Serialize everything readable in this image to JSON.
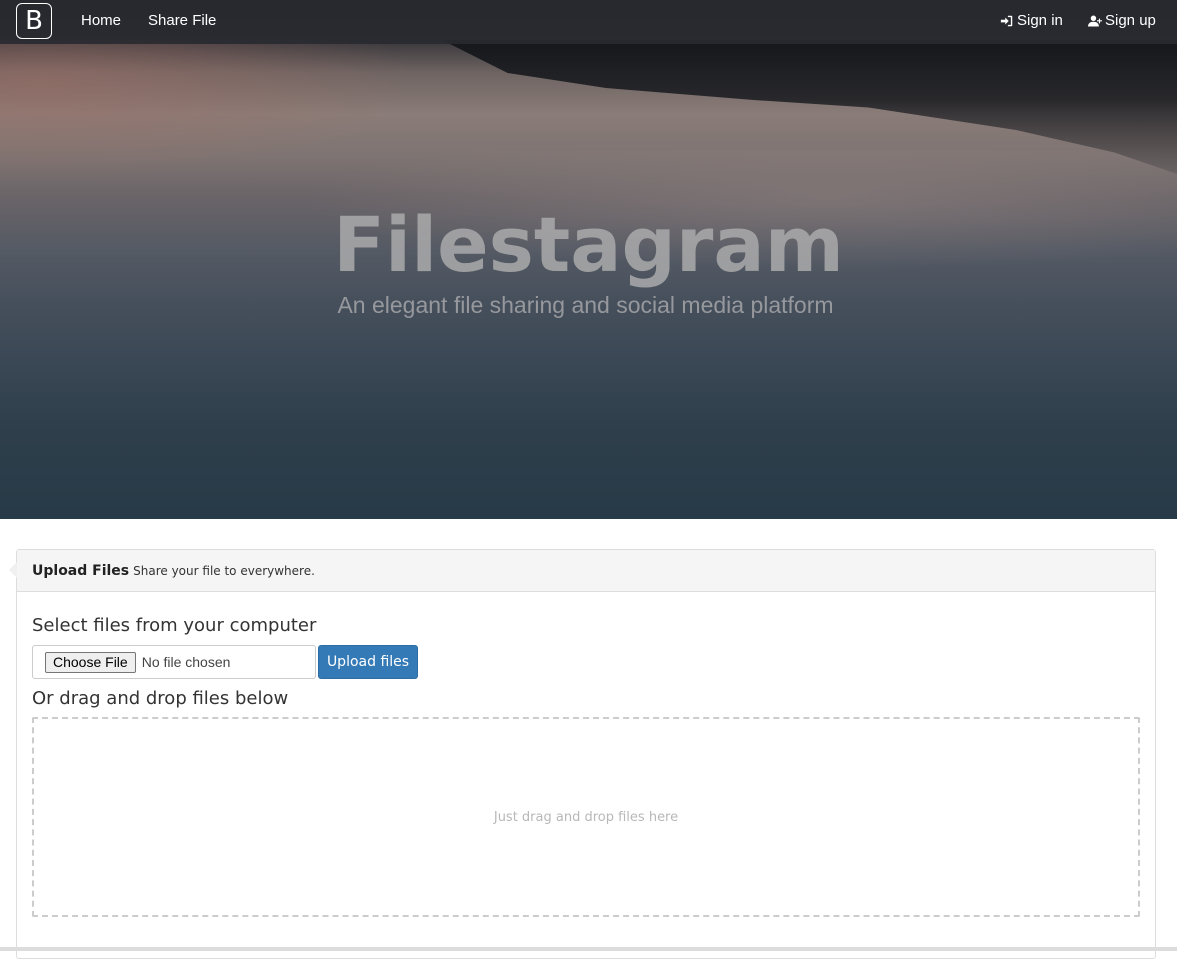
{
  "navbar": {
    "brand": "B",
    "home": "Home",
    "share_file": "Share File",
    "sign_in": "Sign in",
    "sign_up": "Sign up"
  },
  "hero": {
    "title": "Filestagram",
    "subtitle": "An elegant file sharing and social media platform"
  },
  "upload_panel": {
    "title": "Upload Files",
    "description": "Share your file to everywhere.",
    "select_label": "Select files from your computer",
    "choose_file": "Choose File",
    "no_file": "No file chosen",
    "upload_button": "Upload files",
    "drag_label": "Or drag and drop files below",
    "dropzone_text": "Just drag and drop files here"
  },
  "colors": {
    "primary": "#337ab7",
    "navbar": "#282a30"
  },
  "icons": {
    "sign_in": "sign-in-icon",
    "sign_up": "user-plus-icon"
  }
}
